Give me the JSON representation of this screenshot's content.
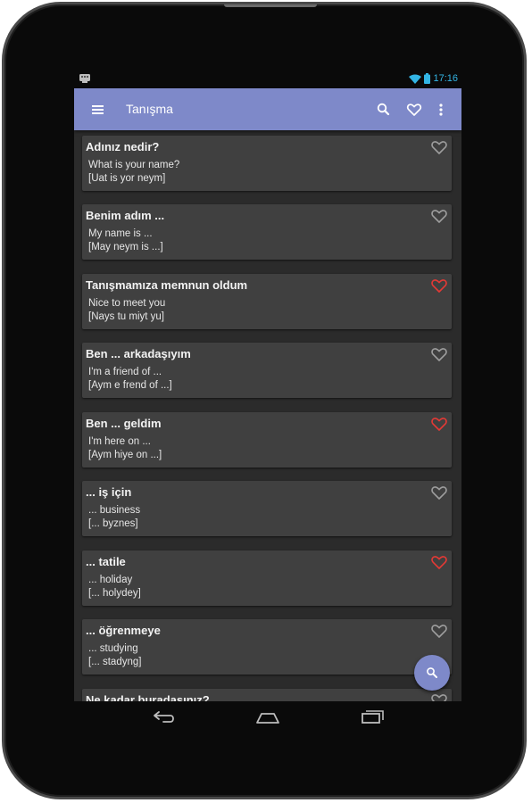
{
  "status_bar": {
    "time": "17:16",
    "left_icon": "notification-icon",
    "right_icons": [
      "wifi-icon",
      "battery-icon"
    ],
    "accent_color": "#33b5e5"
  },
  "app_bar": {
    "title": "Tanışma",
    "color": "#7e89c9",
    "icons": [
      "menu-icon",
      "search-icon",
      "heart-icon",
      "overflow-menu-icon"
    ]
  },
  "phrases": [
    {
      "turkish": "Adınız nedir?",
      "english": "What is your name?",
      "pronunciation": "[Uat is yor neym]",
      "favorite": false
    },
    {
      "turkish": "Benim adım ...",
      "english": "My name is ...",
      "pronunciation": "[May neym is ...]",
      "favorite": false
    },
    {
      "turkish": "Tanışmamıza memnun oldum",
      "english": "Nice to meet you",
      "pronunciation": "[Nays tu miyt yu]",
      "favorite": true
    },
    {
      "turkish": "Ben ... arkadaşıyım",
      "english": "I'm a friend  of ...",
      "pronunciation": "[Aym e frend of ...]",
      "favorite": false
    },
    {
      "turkish": "Ben ... geldim",
      "english": "I'm here  on ...",
      "pronunciation": "[Aym hiye on ...]",
      "favorite": true
    },
    {
      "turkish": "... iş için",
      "english": "... business",
      "pronunciation": "[... byznes]",
      "favorite": false
    },
    {
      "turkish": "... tatile",
      "english": "... holiday",
      "pronunciation": "[... holydey]",
      "favorite": true
    },
    {
      "turkish": "... öğrenmeye",
      "english": "... studying",
      "pronunciation": "[... stadyng]",
      "favorite": false
    },
    {
      "turkish": "Ne kadar buradasınız?",
      "english": "",
      "pronunciation": "",
      "favorite": false
    }
  ],
  "colors": {
    "favorite_on": "#e53935",
    "favorite_off": "#9e9e9e",
    "card": "#404040",
    "background": "#2b2b2b"
  },
  "fab": {
    "icon": "search-icon"
  },
  "nav_bar": {
    "icons": [
      "back-icon",
      "home-icon",
      "recent-apps-icon"
    ]
  }
}
